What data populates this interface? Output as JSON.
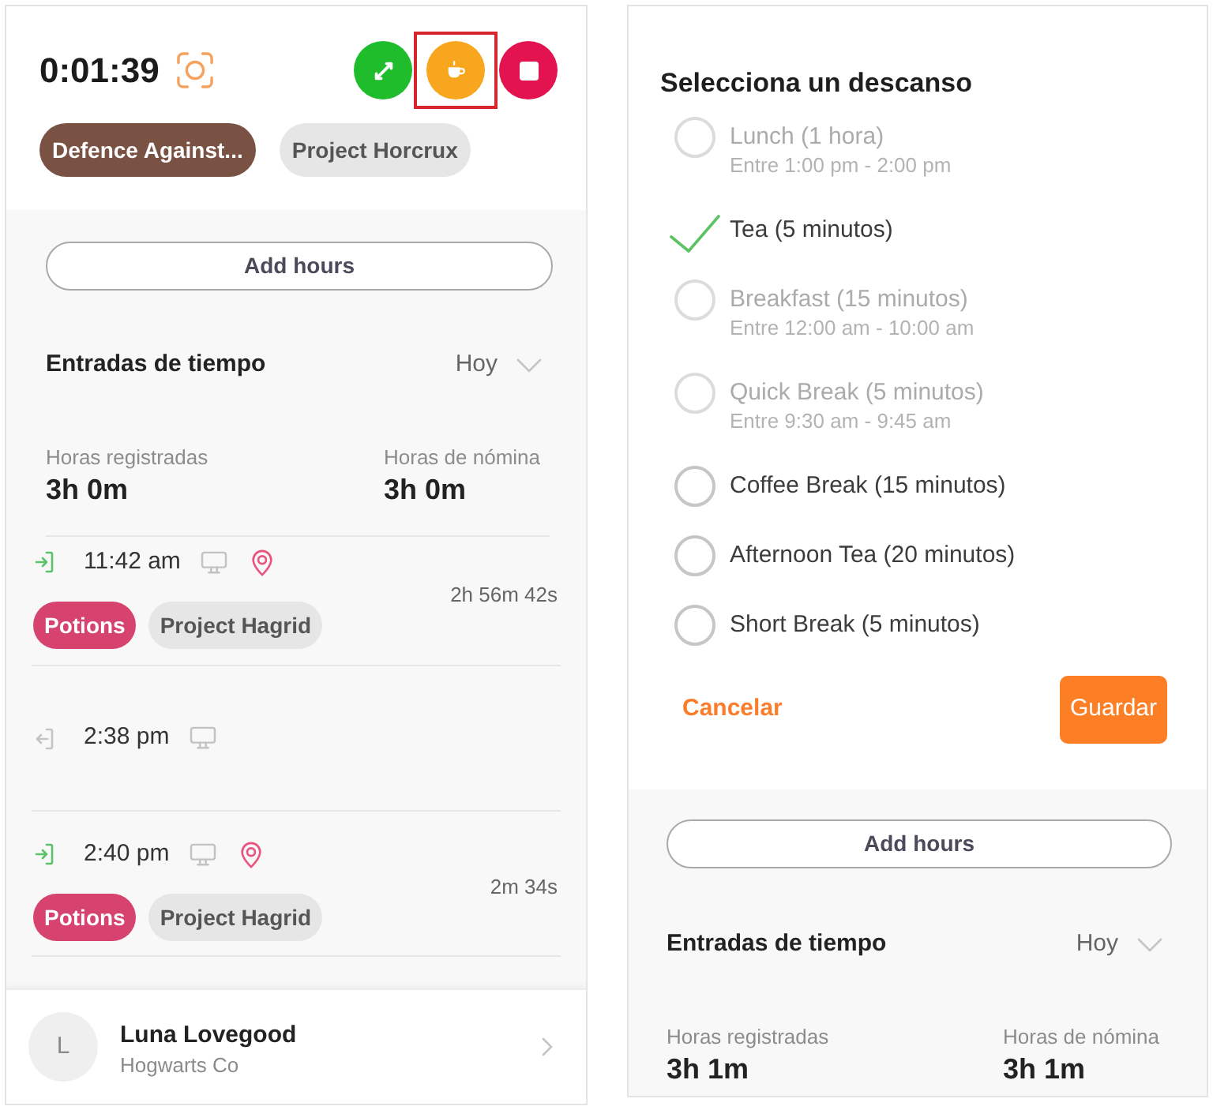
{
  "timer_card": {
    "timer": "0:01:39",
    "actions": [
      {
        "kind": "switch",
        "highlighted": false
      },
      {
        "kind": "break",
        "highlighted": true
      },
      {
        "kind": "stop",
        "highlighted": false
      }
    ],
    "tags": [
      {
        "label": "Defence Against...",
        "color": "#7a5244"
      },
      {
        "label": "Project Horcrux",
        "color": "#e6e6e6"
      }
    ]
  },
  "entries_panel": {
    "add_hours": "Add hours",
    "header": {
      "title": "Entradas de tiempo",
      "filter": "Hoy"
    },
    "totals": [
      {
        "label": "Horas registradas",
        "value": "3h 0m"
      },
      {
        "label": "Horas de nómina",
        "value": "3h 0m"
      }
    ],
    "entries": [
      {
        "kind": "clock_in",
        "time": "11:42 am",
        "location": true,
        "duration": "2h 56m 42s",
        "tags": [
          {
            "label": "Potions",
            "color": "#d6436e"
          },
          {
            "label": "Project Hagrid",
            "color": "#e6e6e6"
          }
        ]
      },
      {
        "kind": "clock_out",
        "time": "2:38 pm",
        "location": false
      },
      {
        "kind": "clock_in",
        "time": "2:40 pm",
        "location": true,
        "duration": "2m 34s",
        "tags": [
          {
            "label": "Potions",
            "color": "#d6436e"
          },
          {
            "label": "Project Hagrid",
            "color": "#e6e6e6"
          }
        ]
      }
    ]
  },
  "user_footer": {
    "initial": "L",
    "name": "Luna Lovegood",
    "company": "Hogwarts Co"
  },
  "break_dialog": {
    "title": "Selecciona un descanso",
    "options": [
      {
        "label": "Lunch (1 hora)",
        "window": "Entre 1:00 pm - 2:00 pm",
        "disabled": true,
        "selected": false
      },
      {
        "label": "Tea (5 minutos)",
        "disabled": false,
        "selected": true
      },
      {
        "label": "Breakfast (15 minutos)",
        "window": "Entre 12:00 am - 10:00 am",
        "disabled": true,
        "selected": false
      },
      {
        "label": "Quick Break (5 minutos)",
        "window": "Entre 9:30 am - 9:45 am",
        "disabled": true,
        "selected": false
      },
      {
        "label": "Coffee Break (15 minutos)",
        "disabled": false,
        "selected": false
      },
      {
        "label": "Afternoon Tea (20 minutos)",
        "disabled": false,
        "selected": false
      },
      {
        "label": "Short Break (5 minutos)",
        "disabled": false,
        "selected": false
      }
    ],
    "cancel": "Cancelar",
    "save": "Guardar"
  },
  "background_panel": {
    "add_hours": "Add hours",
    "header": {
      "title": "Entradas de tiempo",
      "filter": "Hoy"
    },
    "totals": [
      {
        "label": "Horas registradas",
        "value": "3h 1m"
      },
      {
        "label": "Horas de nómina",
        "value": "3h 1m"
      }
    ]
  }
}
